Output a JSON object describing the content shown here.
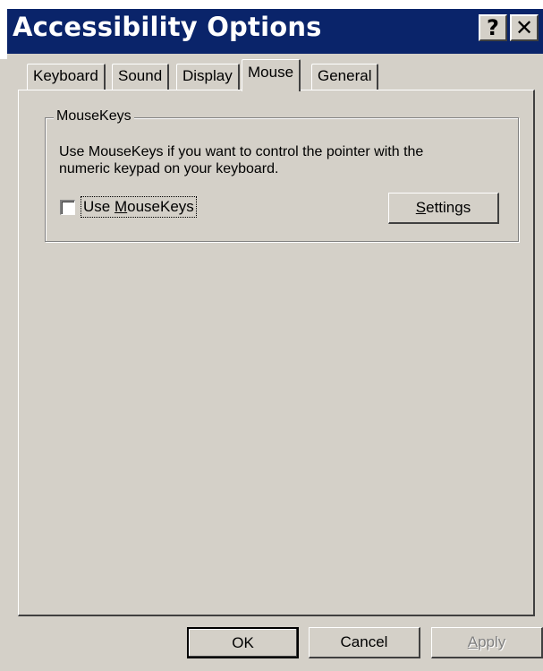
{
  "window": {
    "title": "Accessibility Options",
    "help_glyph": "?",
    "close_glyph": "✕"
  },
  "tabs": [
    {
      "label": "Keyboard",
      "active": false
    },
    {
      "label": "Sound",
      "active": false
    },
    {
      "label": "Display",
      "active": false
    },
    {
      "label": "Mouse",
      "active": true
    },
    {
      "label": "General",
      "active": false
    }
  ],
  "mousekeys": {
    "group_title": "MouseKeys",
    "description_line1": "Use MouseKeys if you want to control the pointer with the",
    "description_line2": "numeric keypad on your keyboard.",
    "checkbox_label_prefix": "Use ",
    "checkbox_label_accel": "M",
    "checkbox_label_rest": "ouseKeys",
    "checkbox_checked": false,
    "settings_accel": "S",
    "settings_rest": "ettings"
  },
  "buttons": {
    "ok": "OK",
    "cancel": "Cancel",
    "apply_accel": "A",
    "apply_rest": "pply",
    "apply_enabled": false
  },
  "colors": {
    "titlebar": "#0a246a",
    "face": "#d4d0c8",
    "disabled_text": "#808080"
  }
}
